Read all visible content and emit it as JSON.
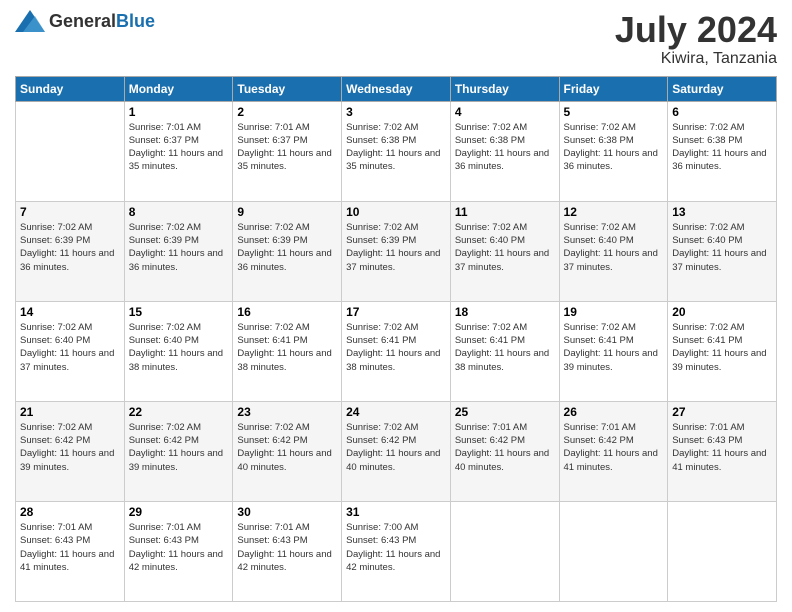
{
  "header": {
    "logo": {
      "general": "General",
      "blue": "Blue"
    },
    "title": "July 2024",
    "location": "Kiwira, Tanzania"
  },
  "days_of_week": [
    "Sunday",
    "Monday",
    "Tuesday",
    "Wednesday",
    "Thursday",
    "Friday",
    "Saturday"
  ],
  "weeks": [
    [
      {
        "day": "",
        "sunrise": "",
        "sunset": "",
        "daylight": ""
      },
      {
        "day": "1",
        "sunrise": "Sunrise: 7:01 AM",
        "sunset": "Sunset: 6:37 PM",
        "daylight": "Daylight: 11 hours and 35 minutes."
      },
      {
        "day": "2",
        "sunrise": "Sunrise: 7:01 AM",
        "sunset": "Sunset: 6:37 PM",
        "daylight": "Daylight: 11 hours and 35 minutes."
      },
      {
        "day": "3",
        "sunrise": "Sunrise: 7:02 AM",
        "sunset": "Sunset: 6:38 PM",
        "daylight": "Daylight: 11 hours and 35 minutes."
      },
      {
        "day": "4",
        "sunrise": "Sunrise: 7:02 AM",
        "sunset": "Sunset: 6:38 PM",
        "daylight": "Daylight: 11 hours and 36 minutes."
      },
      {
        "day": "5",
        "sunrise": "Sunrise: 7:02 AM",
        "sunset": "Sunset: 6:38 PM",
        "daylight": "Daylight: 11 hours and 36 minutes."
      },
      {
        "day": "6",
        "sunrise": "Sunrise: 7:02 AM",
        "sunset": "Sunset: 6:38 PM",
        "daylight": "Daylight: 11 hours and 36 minutes."
      }
    ],
    [
      {
        "day": "7",
        "sunrise": "Sunrise: 7:02 AM",
        "sunset": "Sunset: 6:39 PM",
        "daylight": "Daylight: 11 hours and 36 minutes."
      },
      {
        "day": "8",
        "sunrise": "Sunrise: 7:02 AM",
        "sunset": "Sunset: 6:39 PM",
        "daylight": "Daylight: 11 hours and 36 minutes."
      },
      {
        "day": "9",
        "sunrise": "Sunrise: 7:02 AM",
        "sunset": "Sunset: 6:39 PM",
        "daylight": "Daylight: 11 hours and 36 minutes."
      },
      {
        "day": "10",
        "sunrise": "Sunrise: 7:02 AM",
        "sunset": "Sunset: 6:39 PM",
        "daylight": "Daylight: 11 hours and 37 minutes."
      },
      {
        "day": "11",
        "sunrise": "Sunrise: 7:02 AM",
        "sunset": "Sunset: 6:40 PM",
        "daylight": "Daylight: 11 hours and 37 minutes."
      },
      {
        "day": "12",
        "sunrise": "Sunrise: 7:02 AM",
        "sunset": "Sunset: 6:40 PM",
        "daylight": "Daylight: 11 hours and 37 minutes."
      },
      {
        "day": "13",
        "sunrise": "Sunrise: 7:02 AM",
        "sunset": "Sunset: 6:40 PM",
        "daylight": "Daylight: 11 hours and 37 minutes."
      }
    ],
    [
      {
        "day": "14",
        "sunrise": "Sunrise: 7:02 AM",
        "sunset": "Sunset: 6:40 PM",
        "daylight": "Daylight: 11 hours and 37 minutes."
      },
      {
        "day": "15",
        "sunrise": "Sunrise: 7:02 AM",
        "sunset": "Sunset: 6:40 PM",
        "daylight": "Daylight: 11 hours and 38 minutes."
      },
      {
        "day": "16",
        "sunrise": "Sunrise: 7:02 AM",
        "sunset": "Sunset: 6:41 PM",
        "daylight": "Daylight: 11 hours and 38 minutes."
      },
      {
        "day": "17",
        "sunrise": "Sunrise: 7:02 AM",
        "sunset": "Sunset: 6:41 PM",
        "daylight": "Daylight: 11 hours and 38 minutes."
      },
      {
        "day": "18",
        "sunrise": "Sunrise: 7:02 AM",
        "sunset": "Sunset: 6:41 PM",
        "daylight": "Daylight: 11 hours and 38 minutes."
      },
      {
        "day": "19",
        "sunrise": "Sunrise: 7:02 AM",
        "sunset": "Sunset: 6:41 PM",
        "daylight": "Daylight: 11 hours and 39 minutes."
      },
      {
        "day": "20",
        "sunrise": "Sunrise: 7:02 AM",
        "sunset": "Sunset: 6:41 PM",
        "daylight": "Daylight: 11 hours and 39 minutes."
      }
    ],
    [
      {
        "day": "21",
        "sunrise": "Sunrise: 7:02 AM",
        "sunset": "Sunset: 6:42 PM",
        "daylight": "Daylight: 11 hours and 39 minutes."
      },
      {
        "day": "22",
        "sunrise": "Sunrise: 7:02 AM",
        "sunset": "Sunset: 6:42 PM",
        "daylight": "Daylight: 11 hours and 39 minutes."
      },
      {
        "day": "23",
        "sunrise": "Sunrise: 7:02 AM",
        "sunset": "Sunset: 6:42 PM",
        "daylight": "Daylight: 11 hours and 40 minutes."
      },
      {
        "day": "24",
        "sunrise": "Sunrise: 7:02 AM",
        "sunset": "Sunset: 6:42 PM",
        "daylight": "Daylight: 11 hours and 40 minutes."
      },
      {
        "day": "25",
        "sunrise": "Sunrise: 7:01 AM",
        "sunset": "Sunset: 6:42 PM",
        "daylight": "Daylight: 11 hours and 40 minutes."
      },
      {
        "day": "26",
        "sunrise": "Sunrise: 7:01 AM",
        "sunset": "Sunset: 6:42 PM",
        "daylight": "Daylight: 11 hours and 41 minutes."
      },
      {
        "day": "27",
        "sunrise": "Sunrise: 7:01 AM",
        "sunset": "Sunset: 6:43 PM",
        "daylight": "Daylight: 11 hours and 41 minutes."
      }
    ],
    [
      {
        "day": "28",
        "sunrise": "Sunrise: 7:01 AM",
        "sunset": "Sunset: 6:43 PM",
        "daylight": "Daylight: 11 hours and 41 minutes."
      },
      {
        "day": "29",
        "sunrise": "Sunrise: 7:01 AM",
        "sunset": "Sunset: 6:43 PM",
        "daylight": "Daylight: 11 hours and 42 minutes."
      },
      {
        "day": "30",
        "sunrise": "Sunrise: 7:01 AM",
        "sunset": "Sunset: 6:43 PM",
        "daylight": "Daylight: 11 hours and 42 minutes."
      },
      {
        "day": "31",
        "sunrise": "Sunrise: 7:00 AM",
        "sunset": "Sunset: 6:43 PM",
        "daylight": "Daylight: 11 hours and 42 minutes."
      },
      {
        "day": "",
        "sunrise": "",
        "sunset": "",
        "daylight": ""
      },
      {
        "day": "",
        "sunrise": "",
        "sunset": "",
        "daylight": ""
      },
      {
        "day": "",
        "sunrise": "",
        "sunset": "",
        "daylight": ""
      }
    ]
  ]
}
